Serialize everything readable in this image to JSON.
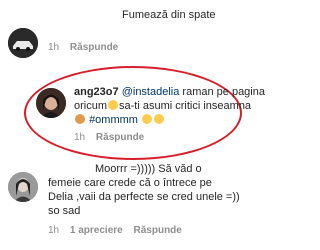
{
  "comments": [
    {
      "text": "Fumează din spate",
      "time": "1h",
      "reply_label": "Răspunde"
    },
    {
      "username": "ang23o7",
      "mention": "@instadelia",
      "line1_rest": "raman pe pagina",
      "line2": "oricum",
      "line2_rest": "sa-ti asumi critici inseamna",
      "hashtag": "#ommmm",
      "time": "1h",
      "reply_label": "Răspunde"
    },
    {
      "lines": [
        "Moorrr =))))) Să văd o",
        "femeie care crede că o întrece pe",
        "Delia ,vaii da perfecte se cred unele =))",
        "so sad"
      ],
      "time": "1h",
      "likes_label": "1 apreciere",
      "reply_label": "Răspunde"
    }
  ],
  "colors": {
    "highlight_oval": "#d61f2b",
    "link": "#003569",
    "muted": "#8e8e8e",
    "emoji": "#ffcc4d"
  }
}
